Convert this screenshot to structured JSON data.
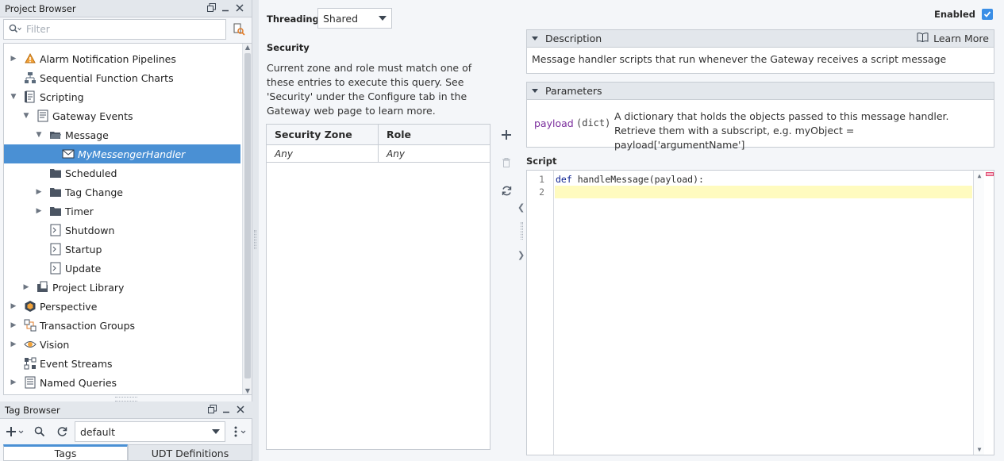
{
  "project_browser": {
    "title": "Project Browser",
    "filter_placeholder": "Filter",
    "tree": [
      {
        "label": "Alarm Notification Pipelines",
        "icon": "alarm-pipeline-icon",
        "expanded": false,
        "selected": false
      },
      {
        "label": "Sequential Function Charts",
        "icon": "sfc-icon",
        "expanded": false,
        "selected": false
      },
      {
        "label": "Scripting",
        "icon": "scripting-icon",
        "expanded": true,
        "selected": false
      },
      {
        "label": "Gateway Events",
        "icon": "gateway-events-icon",
        "expanded": true,
        "selected": false
      },
      {
        "label": "Message",
        "icon": "folder-open-icon",
        "expanded": true,
        "selected": false
      },
      {
        "label": "MyMessengerHandler",
        "icon": "message-handler-icon",
        "expanded": false,
        "selected": true
      },
      {
        "label": "Scheduled",
        "icon": "folder-icon",
        "expanded": false,
        "selected": false
      },
      {
        "label": "Tag Change",
        "icon": "folder-icon",
        "expanded": false,
        "selected": false
      },
      {
        "label": "Timer",
        "icon": "folder-icon",
        "expanded": false,
        "selected": false
      },
      {
        "label": "Shutdown",
        "icon": "script-page-icon",
        "expanded": false,
        "selected": false
      },
      {
        "label": "Startup",
        "icon": "script-page-icon",
        "expanded": false,
        "selected": false
      },
      {
        "label": "Update",
        "icon": "script-page-icon",
        "expanded": false,
        "selected": false
      },
      {
        "label": "Project Library",
        "icon": "library-icon",
        "expanded": false,
        "selected": false
      },
      {
        "label": "Perspective",
        "icon": "perspective-icon",
        "expanded": false,
        "selected": false
      },
      {
        "label": "Transaction Groups",
        "icon": "transaction-groups-icon",
        "expanded": false,
        "selected": false
      },
      {
        "label": "Vision",
        "icon": "vision-icon",
        "expanded": false,
        "selected": false
      },
      {
        "label": "Event Streams",
        "icon": "event-streams-icon",
        "expanded": false,
        "selected": false
      },
      {
        "label": "Named Queries",
        "icon": "named-queries-icon",
        "expanded": false,
        "selected": false
      }
    ]
  },
  "tag_browser": {
    "title": "Tag Browser",
    "provider": "default",
    "tabs": [
      {
        "label": "Tags",
        "active": true
      },
      {
        "label": "UDT Definitions",
        "active": false
      }
    ]
  },
  "settings": {
    "threading_label": "Threading",
    "threading_value": "Shared",
    "security_label": "Security",
    "security_description": "Current zone and role must match one of these entries to execute this query. See 'Security' under the Configure tab in the Gateway web page to learn more.",
    "security_table": {
      "headers": [
        "Security Zone",
        "Role"
      ],
      "rows": [
        [
          "Any",
          "Any"
        ]
      ]
    },
    "enabled_label": "Enabled",
    "enabled": true
  },
  "description": {
    "title": "Description",
    "learn_more": "Learn More",
    "text": "Message handler scripts that run whenever the Gateway receives a script message"
  },
  "parameters": {
    "title": "Parameters",
    "name": "payload",
    "type": "(dict)",
    "text": "A dictionary that holds the objects passed to this message handler. Retrieve them with a subscript, e.g. myObject = payload['argumentName']"
  },
  "script": {
    "label": "Script",
    "lines": [
      {
        "number": "1",
        "keyword": "def",
        "rest": " handleMessage(payload):"
      },
      {
        "number": "2",
        "keyword": "",
        "rest": ""
      }
    ]
  },
  "colors": {
    "selection": "#4a90d4",
    "accent": "#3a8ee6",
    "current_line": "#fffbbf",
    "keyword": "#0a1f8f"
  }
}
